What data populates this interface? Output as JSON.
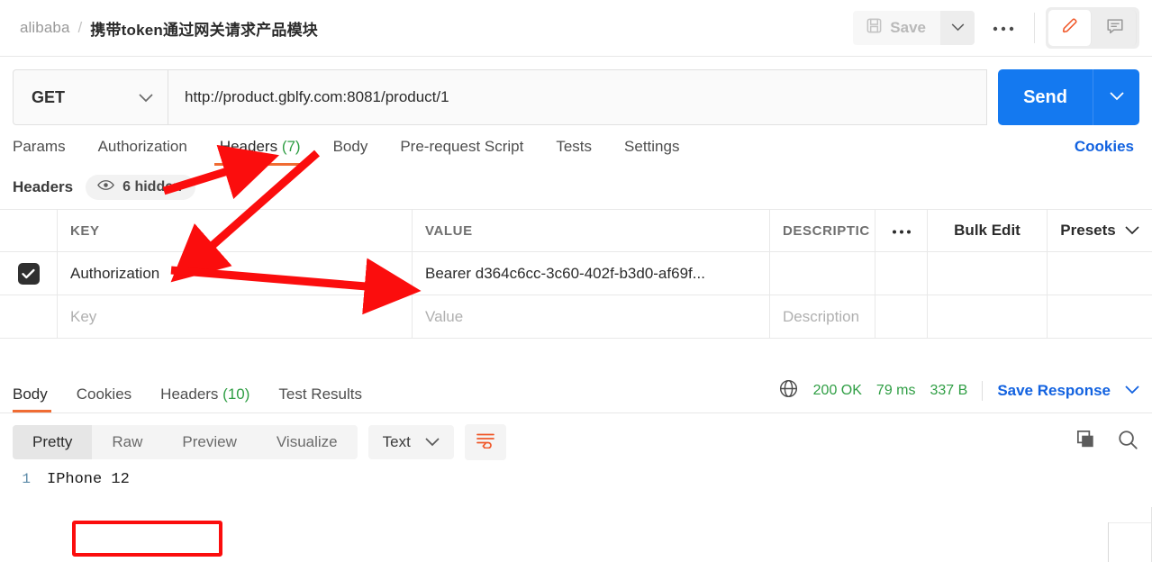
{
  "breadcrumb": {
    "collection": "alibaba",
    "separator": "/",
    "request_title": "携带token通过网关请求产品模块"
  },
  "topbar": {
    "save_label": "Save",
    "save_caret_icon": "chevron-down-icon",
    "more_icon": "ellipsis-icon",
    "edit_icon": "pencil-icon",
    "comment_icon": "comment-icon"
  },
  "request": {
    "method": "GET",
    "method_caret_icon": "chevron-down-icon",
    "url": "http://product.gblfy.com:8081/product/1",
    "send_label": "Send",
    "send_caret_icon": "chevron-down-icon",
    "tabs": [
      {
        "label": "Params",
        "count": "",
        "active": false
      },
      {
        "label": "Authorization",
        "count": "",
        "active": false
      },
      {
        "label": "Headers",
        "count": "(7)",
        "active": true
      },
      {
        "label": "Body",
        "count": "",
        "active": false
      },
      {
        "label": "Pre-request Script",
        "count": "",
        "active": false
      },
      {
        "label": "Tests",
        "count": "",
        "active": false
      },
      {
        "label": "Settings",
        "count": "",
        "active": false
      }
    ],
    "cookies_link": "Cookies"
  },
  "headers_panel": {
    "title": "Headers",
    "eye_icon": "eye-icon",
    "hidden_label": "6 hidden",
    "columns": {
      "key": "KEY",
      "value": "VALUE",
      "description": "DESCRIPTIC",
      "more_icon": "ellipsis-icon",
      "bulk_edit": "Bulk Edit",
      "presets": "Presets",
      "presets_caret_icon": "chevron-down-icon"
    },
    "rows": [
      {
        "checked": true,
        "key": "Authorization",
        "value": "Bearer d364c6cc-3c60-402f-b3d0-af69f...",
        "description": ""
      }
    ],
    "placeholder_row": {
      "key": "Key",
      "value": "Value",
      "description": "Description"
    }
  },
  "response": {
    "tabs": [
      {
        "label": "Body",
        "count": "",
        "active": true
      },
      {
        "label": "Cookies",
        "count": "",
        "active": false
      },
      {
        "label": "Headers",
        "count": "(10)",
        "active": false
      },
      {
        "label": "Test Results",
        "count": "",
        "active": false
      }
    ],
    "globe_icon": "globe-icon",
    "status": "200 OK",
    "time": "79 ms",
    "size": "337 B",
    "save_response": "Save Response",
    "save_response_caret_icon": "chevron-down-icon",
    "view_modes": [
      {
        "label": "Pretty",
        "active": true
      },
      {
        "label": "Raw",
        "active": false
      },
      {
        "label": "Preview",
        "active": false
      },
      {
        "label": "Visualize",
        "active": false
      }
    ],
    "format": "Text",
    "format_caret_icon": "chevron-down-icon",
    "wrap_icon": "word-wrap-icon",
    "copy_icon": "copy-icon",
    "search_icon": "search-icon",
    "body_lines": [
      {
        "number": "1",
        "text": "IPhone 12"
      }
    ]
  },
  "colors": {
    "accent_orange": "#f06c33",
    "link_blue": "#1262e0",
    "send_blue": "#1479f0",
    "status_green": "#2f9e44",
    "annotation_red": "#fb0d0d"
  }
}
